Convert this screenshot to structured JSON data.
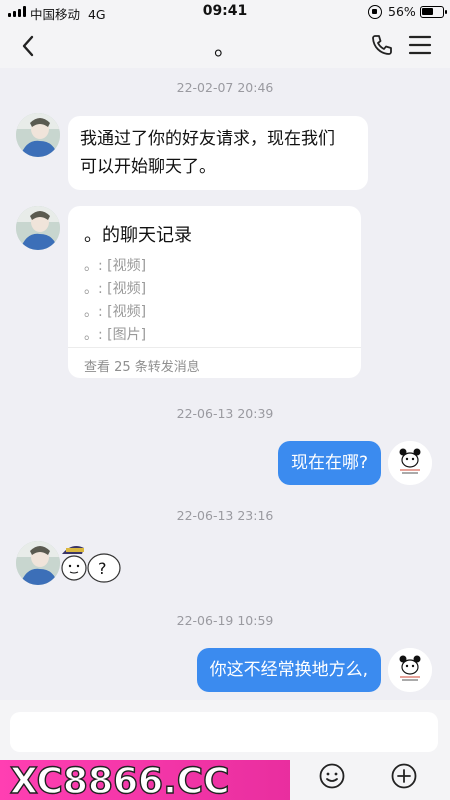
{
  "status": {
    "carrier": "中国移动",
    "network": "4G",
    "time": "09:41",
    "battery": "56%"
  },
  "header": {
    "title": "。"
  },
  "messages": {
    "time1": "22-02-07 20:46",
    "msg1": "我通过了你的好友请求，现在我们",
    "msg1_line2": "可以开始聊天了。",
    "card_title": "。的聊天记录",
    "card_lines": [
      "。: [视频]",
      "。: [视频]",
      "。: [视频]",
      "。: [图片]"
    ],
    "card_footer": "查看 25 条转发消息",
    "time2": "22-06-13 20:39",
    "msg_right1": "现在在哪?",
    "time3": "22-06-13 23:16",
    "time4": "22-06-19 10:59",
    "msg_right2": "你这不经常换地方么,"
  },
  "input": {
    "placeholder": ""
  },
  "watermark": {
    "text": "XC8866.CC"
  },
  "colors": {
    "accent": "#3b8bef",
    "background": "#efeff4",
    "watermark": "#ff3fb2"
  }
}
